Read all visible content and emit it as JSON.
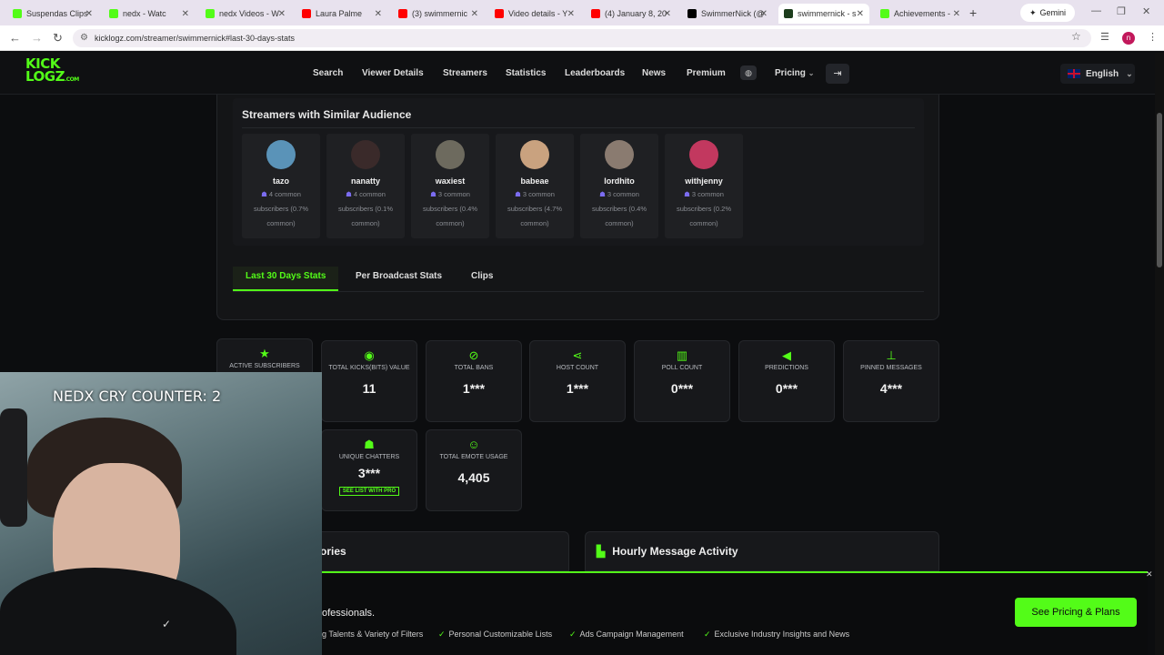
{
  "browser": {
    "tabs": [
      {
        "label": "Suspendas Clips",
        "color": "#53fc18"
      },
      {
        "label": "nedx - Watc",
        "color": "#53fc18"
      },
      {
        "label": "nedx Videos - W",
        "color": "#53fc18"
      },
      {
        "label": "Laura Palme",
        "color": "#ff0000"
      },
      {
        "label": "(3) swimmernic",
        "color": "#ff0000"
      },
      {
        "label": "Video details - Y",
        "color": "#ff0000"
      },
      {
        "label": "(4) January 8, 20",
        "color": "#ff0000"
      },
      {
        "label": "SwimmerNick (@",
        "color": "#000000"
      },
      {
        "label": "swimmernick - s",
        "color": "#1c3d1c"
      },
      {
        "label": "Achievements -",
        "color": "#53fc18"
      }
    ],
    "gemini": "Gemini",
    "url": "kicklogz.com/streamer/swimmernick#last-30-days-stats",
    "profile_initial": "n"
  },
  "site": {
    "logo_top": "KICK",
    "logo_bottom": "LOGZ",
    "logo_suffix": ".COM",
    "nav": [
      "Search",
      "Viewer Details",
      "Streamers",
      "Statistics",
      "Leaderboards",
      "News",
      "Premium"
    ],
    "pricing": "Pricing",
    "language": "English"
  },
  "similar": {
    "title": "Streamers with Similar Audience",
    "streamers": [
      {
        "name": "tazo",
        "common": "4 common subscribers (0.7% common)",
        "color": "#5a93b8"
      },
      {
        "name": "nanatty",
        "common": "4 common subscribers (0.1% common)",
        "color": "#3a2a2a"
      },
      {
        "name": "waxiest",
        "common": "3 common subscribers (0.4% common)",
        "color": "#6d6a5e"
      },
      {
        "name": "babeae",
        "common": "3 common subscribers (4.7% common)",
        "color": "#c9a27f"
      },
      {
        "name": "lordhito",
        "common": "3 common subscribers (0.4% common)",
        "color": "#8a7b70"
      },
      {
        "name": "withjenny",
        "common": "3 common subscribers (0.2% common)",
        "color": "#c2385f"
      }
    ]
  },
  "tabs": {
    "last30": "Last 30 Days Stats",
    "per_broadcast": "Per Broadcast Stats",
    "clips": "Clips"
  },
  "stats": [
    {
      "label": "Active Subscribers",
      "value": "",
      "icon": "star-icon",
      "glyph": "★"
    },
    {
      "label": "Total Kicks(Bits) Value",
      "value": "11",
      "icon": "coins-icon",
      "glyph": "◉"
    },
    {
      "label": "Total Bans",
      "value": "1***",
      "icon": "ban-icon",
      "glyph": "⊘"
    },
    {
      "label": "Host Count",
      "value": "1***",
      "icon": "share-icon",
      "glyph": "⋖"
    },
    {
      "label": "Poll Count",
      "value": "0***",
      "icon": "poll-icon",
      "glyph": "▥"
    },
    {
      "label": "Predictions",
      "value": "0***",
      "icon": "megaphone-icon",
      "glyph": "◀"
    },
    {
      "label": "Pinned Messages",
      "value": "4***",
      "icon": "pin-icon",
      "glyph": "⊥"
    },
    {
      "label": "Unique Chatters",
      "value": "3***",
      "icon": "users-icon",
      "glyph": "☗",
      "pro": "SEE LIST WITH PRO"
    },
    {
      "label": "Total Emote Usage",
      "value": "4,405",
      "icon": "smile-icon",
      "glyph": "☺"
    }
  ],
  "sections": {
    "left_partial": "ories",
    "hourly": "Hourly Message Activity"
  },
  "promo": {
    "text": "ofessionals.",
    "features": [
      "g Talents & Variety of Filters",
      "Personal Customizable Lists",
      "Ads Campaign Management",
      "Exclusive Industry Insights and News"
    ],
    "cta": "See Pricing & Plans"
  },
  "webcam": {
    "overlay": "NEDX CRY COUNTER: 2"
  }
}
